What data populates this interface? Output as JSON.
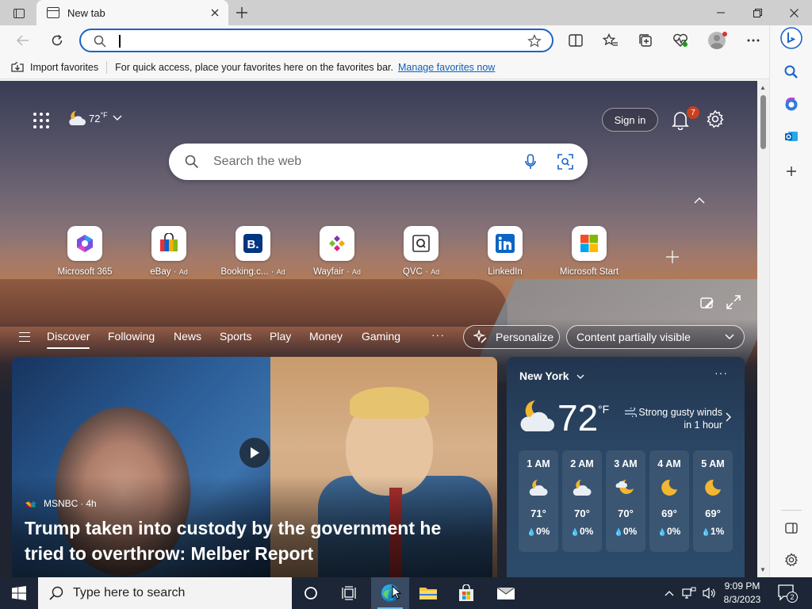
{
  "browser": {
    "tab_title": "New tab",
    "address_value": "",
    "favorites_bar": {
      "import_label": "Import favorites",
      "message": "For quick access, place your favorites here on the favorites bar.",
      "link": "Manage favorites now"
    }
  },
  "newtab": {
    "weather_mini": {
      "temp": "72",
      "unit": "°F"
    },
    "sign_in": "Sign in",
    "notification_count": "7",
    "search_placeholder": "Search the web",
    "quick_links": [
      {
        "name": "Microsoft 365",
        "ad": ""
      },
      {
        "name": "eBay",
        "ad": "Ad"
      },
      {
        "name": "Booking.c...",
        "ad": "Ad"
      },
      {
        "name": "Wayfair",
        "ad": "Ad"
      },
      {
        "name": "QVC",
        "ad": "Ad"
      },
      {
        "name": "LinkedIn",
        "ad": ""
      },
      {
        "name": "Microsoft Start",
        "ad": ""
      }
    ],
    "feed_tabs": [
      "Discover",
      "Following",
      "News",
      "Sports",
      "Play",
      "Money",
      "Gaming"
    ],
    "feed_more": "···",
    "personalize": "Personalize",
    "content_visibility": "Content partially visible",
    "hero": {
      "source": "MSNBC",
      "age": "4h",
      "title": "Trump taken into custody by the government he tried to overthrow: Melber Report"
    },
    "weather": {
      "city": "New York",
      "temp": "72",
      "unit": "°F",
      "alert_line1": "Strong gusty winds",
      "alert_line2": "in 1 hour",
      "hourly": [
        {
          "time": "1 AM",
          "temp": "71°",
          "precip": "0%",
          "icon": "partly-cloudy-night-icon"
        },
        {
          "time": "2 AM",
          "temp": "70°",
          "precip": "0%",
          "icon": "partly-cloudy-night-icon"
        },
        {
          "time": "3 AM",
          "temp": "70°",
          "precip": "0%",
          "icon": "cloudy-moon-icon"
        },
        {
          "time": "4 AM",
          "temp": "69°",
          "precip": "0%",
          "icon": "moon-icon"
        },
        {
          "time": "5 AM",
          "temp": "69°",
          "precip": "1%",
          "icon": "moon-icon"
        }
      ]
    }
  },
  "taskbar": {
    "search_placeholder": "Type here to search",
    "time": "9:09 PM",
    "date": "8/3/2023",
    "notification_count": "2"
  },
  "colors": {
    "accent": "#1a64c8",
    "taskbar": "#1c2636",
    "badge": "#c9401e"
  }
}
